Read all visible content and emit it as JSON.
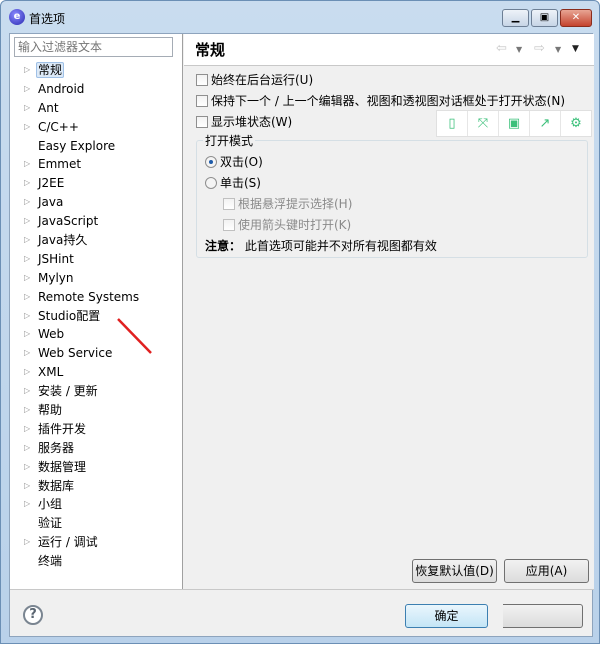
{
  "window": {
    "title": "首选项",
    "icon": "eclipse-app-icon",
    "controls": [
      "minimize",
      "maximize",
      "close"
    ]
  },
  "filter": {
    "placeholder": "输入过滤器文本"
  },
  "tree": [
    {
      "label": "常规",
      "expandable": true,
      "selected": true
    },
    {
      "label": "Android",
      "expandable": true
    },
    {
      "label": "Ant",
      "expandable": true
    },
    {
      "label": "C/C++",
      "expandable": true
    },
    {
      "label": "Easy Explore",
      "expandable": false
    },
    {
      "label": "Emmet",
      "expandable": true
    },
    {
      "label": "J2EE",
      "expandable": true
    },
    {
      "label": "Java",
      "expandable": true
    },
    {
      "label": "JavaScript",
      "expandable": true
    },
    {
      "label": "Java持久",
      "expandable": true
    },
    {
      "label": "JSHint",
      "expandable": true
    },
    {
      "label": "Mylyn",
      "expandable": true
    },
    {
      "label": "Remote Systems",
      "expandable": true
    },
    {
      "label": "Studio配置",
      "expandable": true
    },
    {
      "label": "Web",
      "expandable": true
    },
    {
      "label": "Web Service",
      "expandable": true
    },
    {
      "label": "XML",
      "expandable": true
    },
    {
      "label": "安装 / 更新",
      "expandable": true
    },
    {
      "label": "帮助",
      "expandable": true
    },
    {
      "label": "插件开发",
      "expandable": true
    },
    {
      "label": "服务器",
      "expandable": true
    },
    {
      "label": "数据管理",
      "expandable": true
    },
    {
      "label": "数据库",
      "expandable": true
    },
    {
      "label": "小组",
      "expandable": true
    },
    {
      "label": "验证",
      "expandable": false
    },
    {
      "label": "运行 / 调试",
      "expandable": true
    },
    {
      "label": "终端",
      "expandable": false
    }
  ],
  "page": {
    "title": "常规",
    "options": [
      {
        "label": "始终在后台运行(U)",
        "checked": false
      },
      {
        "label": "保持下一个 / 上一个编辑器、视图和透视图对话框处于打开状态(N)",
        "checked": false
      },
      {
        "label": "显示堆状态(W)",
        "checked": false
      }
    ],
    "open_mode": {
      "label": "打开模式",
      "double": "双击(O)",
      "single": "单击(S)",
      "selected": "double",
      "sub": [
        "根据悬浮提示选择(H)",
        "使用箭头键时打开(K)"
      ],
      "note_label": "注意：",
      "note": "此首选项可能并不对所有视图都有效"
    },
    "overlay_toolbar": [
      "phone-icon",
      "expand-icon",
      "save-icon",
      "share-icon",
      "settings-icon"
    ],
    "restore_defaults": "恢复默认值(D)",
    "apply": "应用(A)"
  },
  "footer": {
    "ok": "确定",
    "cancel": ""
  },
  "colors": {
    "toolbar_icons": "#3bc07a",
    "annotation_stroke": "#e02020"
  }
}
